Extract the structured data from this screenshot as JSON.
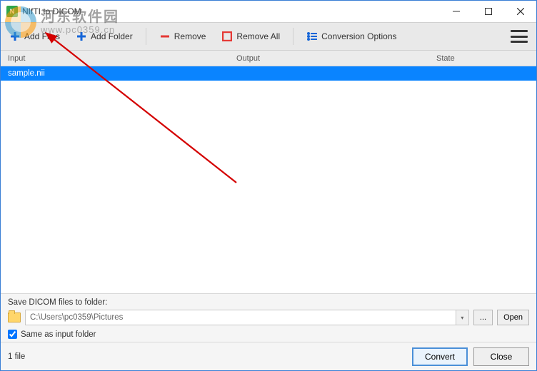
{
  "title": "NIfTI to DICOM",
  "toolbar": {
    "add_files": "Add Files",
    "add_folder": "Add Folder",
    "remove": "Remove",
    "remove_all": "Remove All",
    "conversion_options": "Conversion Options"
  },
  "columns": {
    "input": "Input",
    "output": "Output",
    "state": "State"
  },
  "rows": [
    {
      "input": "sample.nii",
      "output": "",
      "state": ""
    }
  ],
  "save": {
    "label": "Save DICOM files to folder:",
    "path": "C:\\Users\\pc0359\\Pictures",
    "browse": "...",
    "open": "Open",
    "same_as_input": "Same as input folder",
    "same_checked": true
  },
  "footer": {
    "status": "1 file",
    "convert": "Convert",
    "close": "Close"
  },
  "watermark": {
    "cn": "河东软件园",
    "url": "www.pc0359.cn"
  }
}
